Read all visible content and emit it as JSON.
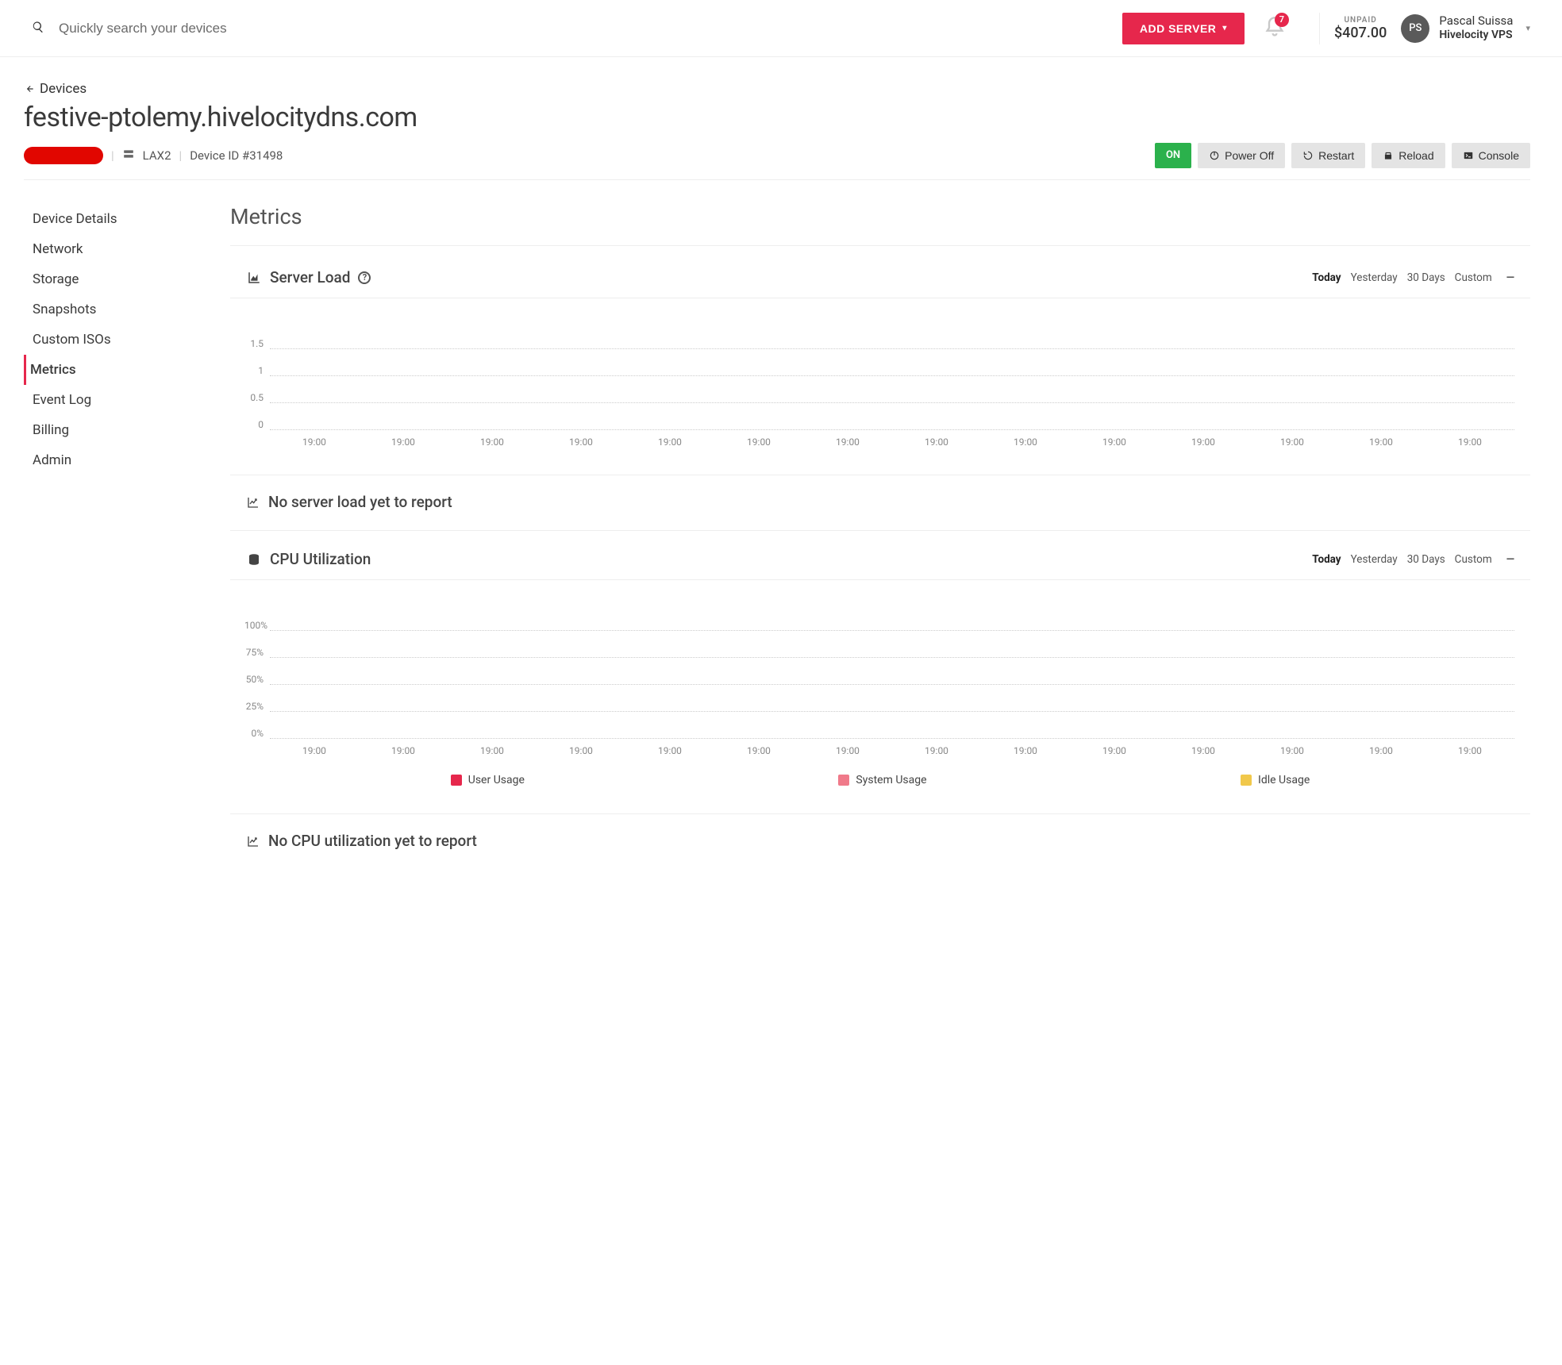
{
  "header": {
    "search_placeholder": "Quickly search your devices",
    "add_server_label": "ADD SERVER",
    "notification_count": "7",
    "unpaid_label": "UNPAID",
    "unpaid_amount": "$407.00",
    "avatar_initials": "PS",
    "user_name": "Pascal Suissa",
    "user_org": "Hivelocity VPS"
  },
  "breadcrumb": {
    "label": "Devices"
  },
  "device": {
    "title": "festive-ptolemy.hivelocitydns.com",
    "location": "LAX2",
    "device_id_label": "Device ID #31498",
    "status": "ON"
  },
  "actions": {
    "power_off": "Power Off",
    "restart": "Restart",
    "reload": "Reload",
    "console": "Console"
  },
  "sidebar": {
    "items": [
      {
        "label": "Device Details"
      },
      {
        "label": "Network"
      },
      {
        "label": "Storage"
      },
      {
        "label": "Snapshots"
      },
      {
        "label": "Custom ISOs"
      },
      {
        "label": "Metrics"
      },
      {
        "label": "Event Log"
      },
      {
        "label": "Billing"
      },
      {
        "label": "Admin"
      }
    ],
    "active_index": 5
  },
  "main": {
    "section_title": "Metrics",
    "range_tabs": [
      "Today",
      "Yesterday",
      "30 Days",
      "Custom"
    ],
    "active_range": "Today",
    "server_load": {
      "title": "Server Load",
      "no_data": "No server load yet to report"
    },
    "cpu": {
      "title": "CPU Utilization",
      "no_data": "No CPU utilization yet to report",
      "legend": [
        {
          "label": "User Usage",
          "color": "#e6274c"
        },
        {
          "label": "System Usage",
          "color": "#f07a8a"
        },
        {
          "label": "Idle Usage",
          "color": "#f1c84b"
        }
      ]
    }
  },
  "chart_data": [
    {
      "type": "line",
      "title": "Server Load",
      "y_ticks": [
        "1.5",
        "1",
        "0.5",
        "0"
      ],
      "x_ticks": [
        "19:00",
        "19:00",
        "19:00",
        "19:00",
        "19:00",
        "19:00",
        "19:00",
        "19:00",
        "19:00",
        "19:00",
        "19:00",
        "19:00",
        "19:00",
        "19:00"
      ],
      "series": [],
      "ylim": [
        0,
        1.5
      ]
    },
    {
      "type": "line",
      "title": "CPU Utilization",
      "y_ticks": [
        "100%",
        "75%",
        "50%",
        "25%",
        "0%"
      ],
      "x_ticks": [
        "19:00",
        "19:00",
        "19:00",
        "19:00",
        "19:00",
        "19:00",
        "19:00",
        "19:00",
        "19:00",
        "19:00",
        "19:00",
        "19:00",
        "19:00",
        "19:00"
      ],
      "series": [
        {
          "name": "User Usage",
          "values": []
        },
        {
          "name": "System Usage",
          "values": []
        },
        {
          "name": "Idle Usage",
          "values": []
        }
      ],
      "ylim": [
        0,
        100
      ]
    }
  ]
}
